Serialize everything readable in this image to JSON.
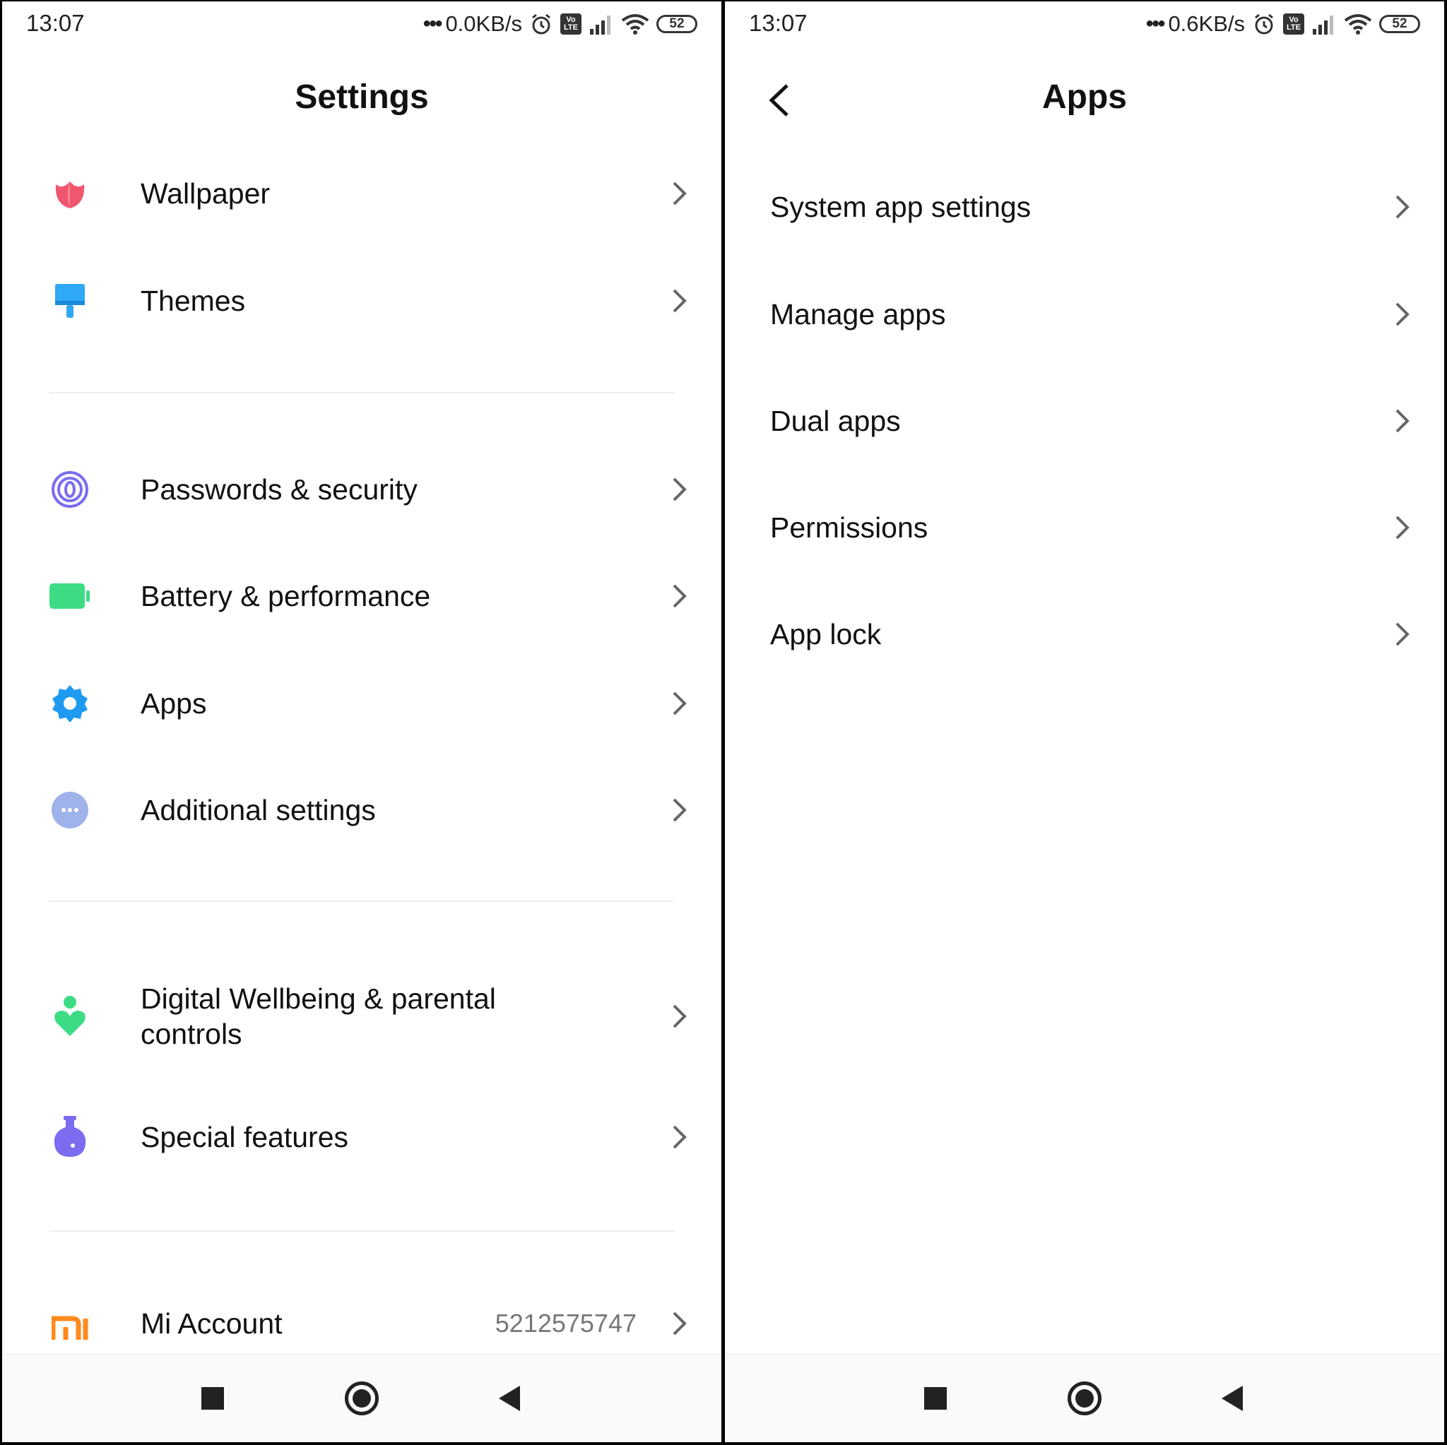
{
  "left_screen": {
    "status": {
      "time": "13:07",
      "dots": "•••",
      "speed": "0.0KB/s",
      "volte_top": "Vo",
      "volte_bottom": "LTE",
      "battery": "52"
    },
    "title": "Settings",
    "items": [
      {
        "label": "Wallpaper",
        "icon": "tulip-icon"
      },
      {
        "label": "Themes",
        "icon": "paintbrush-icon"
      },
      {
        "label": "Passwords & security",
        "icon": "fingerprint-icon"
      },
      {
        "label": "Battery & performance",
        "icon": "battery-icon"
      },
      {
        "label": "Apps",
        "icon": "gear-icon"
      },
      {
        "label": "Additional settings",
        "icon": "more-dots-icon"
      },
      {
        "label": "Digital Wellbeing & parental controls",
        "icon": "wellbeing-heart-icon"
      },
      {
        "label": "Special features",
        "icon": "flask-icon"
      },
      {
        "label": "Mi Account",
        "icon": "mi-logo-icon",
        "value": "5212575747"
      }
    ]
  },
  "right_screen": {
    "status": {
      "time": "13:07",
      "dots": "•••",
      "speed": "0.6KB/s",
      "volte_top": "Vo",
      "volte_bottom": "LTE",
      "battery": "52"
    },
    "title": "Apps",
    "items": [
      {
        "label": "System app settings"
      },
      {
        "label": "Manage apps"
      },
      {
        "label": "Dual apps"
      },
      {
        "label": "Permissions"
      },
      {
        "label": "App lock"
      }
    ]
  },
  "colors": {
    "wallpaper": "#f0566e",
    "themes": "#2fa8f5",
    "security": "#7b6cf0",
    "battery": "#3ddc84",
    "apps": "#1e9bf0",
    "additional": "#9fb2ea",
    "wellbeing": "#3ddc84",
    "special": "#7b6cf0",
    "mi": "#ff8a1e"
  }
}
